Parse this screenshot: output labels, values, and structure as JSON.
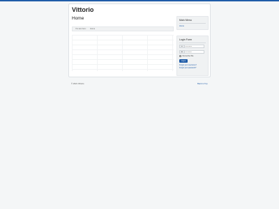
{
  "site": {
    "brand": "Vittorio"
  },
  "page": {
    "title": "Home"
  },
  "breadcrumb": {
    "you_are_here": "You are here:",
    "current": "Home"
  },
  "sidebar": {
    "main_menu": {
      "title": "Main Menu",
      "items": [
        {
          "label": "Home"
        }
      ]
    },
    "login": {
      "title": "Login Form",
      "username_placeholder": "Username",
      "password_placeholder": "Password",
      "remember_label": "Remember Me",
      "login_button": "Log in",
      "forgot_username": "Forgot your username?",
      "forgot_password": "Forgot your password?"
    }
  },
  "footer": {
    "copyright": "© 2021 Vittorio",
    "back_to_top": "Back to Top"
  },
  "colors": {
    "accent": "#1f5ca8",
    "background": "#f4f6f7"
  }
}
